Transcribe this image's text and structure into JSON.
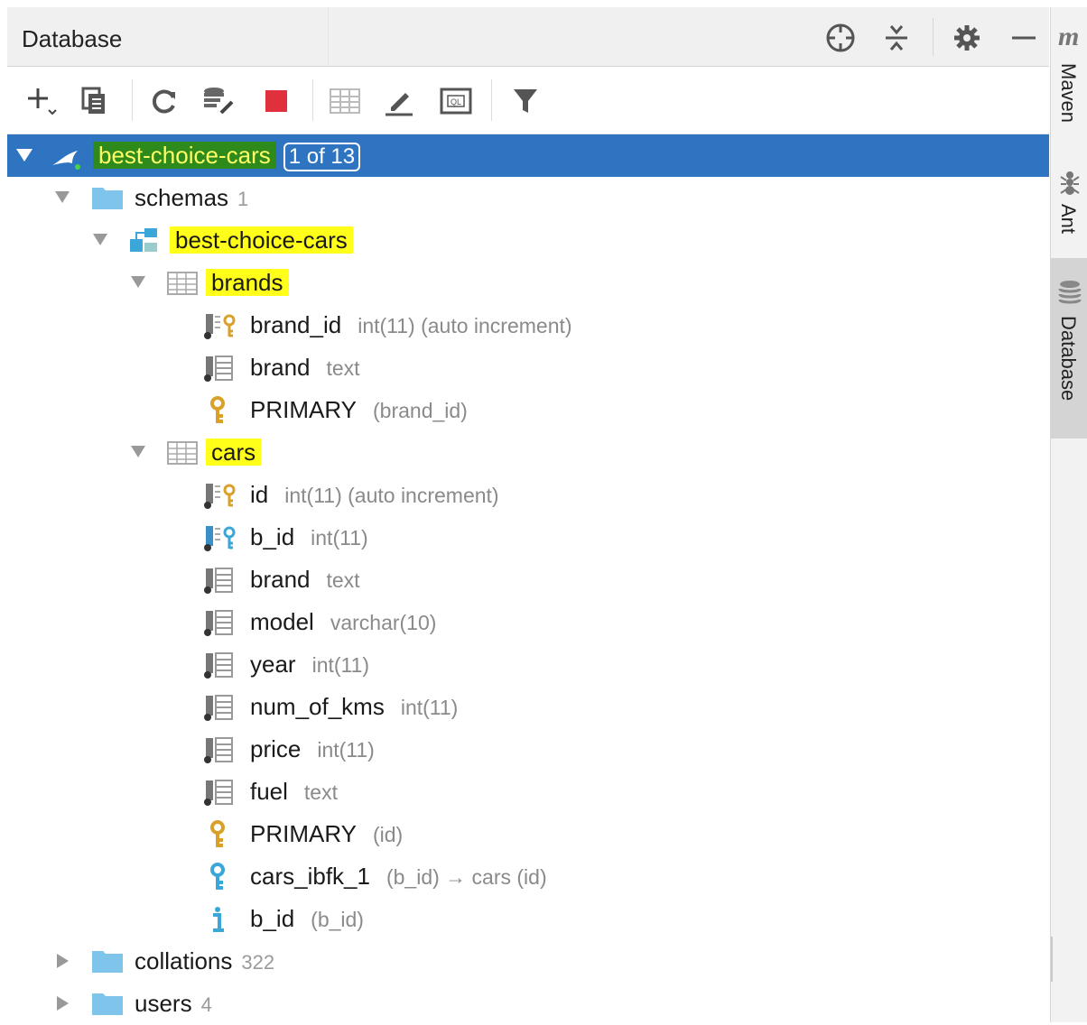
{
  "panel": {
    "title": "Database"
  },
  "tree": {
    "root": {
      "label": "best-choice-cars",
      "badge": "1 of 13"
    },
    "schemas": {
      "label": "schemas",
      "count": "1"
    },
    "schema": {
      "label": "best-choice-cars"
    },
    "brands": {
      "label": "brands",
      "columns": [
        {
          "name": "brand_id",
          "meta": "int(11) (auto increment)"
        },
        {
          "name": "brand",
          "meta": "text"
        }
      ],
      "primary": {
        "name": "PRIMARY",
        "meta": "(brand_id)"
      }
    },
    "cars": {
      "label": "cars",
      "columns": [
        {
          "name": "id",
          "meta": "int(11) (auto increment)"
        },
        {
          "name": "b_id",
          "meta": "int(11)"
        },
        {
          "name": "brand",
          "meta": "text"
        },
        {
          "name": "model",
          "meta": "varchar(10)"
        },
        {
          "name": "year",
          "meta": "int(11)"
        },
        {
          "name": "num_of_kms",
          "meta": "int(11)"
        },
        {
          "name": "price",
          "meta": "int(11)"
        },
        {
          "name": "fuel",
          "meta": "text"
        }
      ],
      "primary": {
        "name": "PRIMARY",
        "meta": "(id)"
      },
      "foreign_key": {
        "name": "cars_ibfk_1",
        "meta": "(b_id) → cars (id)"
      },
      "index": {
        "name": "b_id",
        "meta": "(b_id)"
      }
    },
    "collations": {
      "label": "collations",
      "count": "322"
    },
    "users": {
      "label": "users",
      "count": "4"
    }
  },
  "right_sidebar": {
    "logo": "m",
    "tabs": [
      "Maven",
      "Ant",
      "Database"
    ]
  },
  "colors": {
    "selection": "#2f74c0",
    "highlight": "#ffff1a",
    "folder": "#7fc4ea",
    "key_gold": "#d9a12a",
    "key_blue": "#3aa7d8"
  }
}
